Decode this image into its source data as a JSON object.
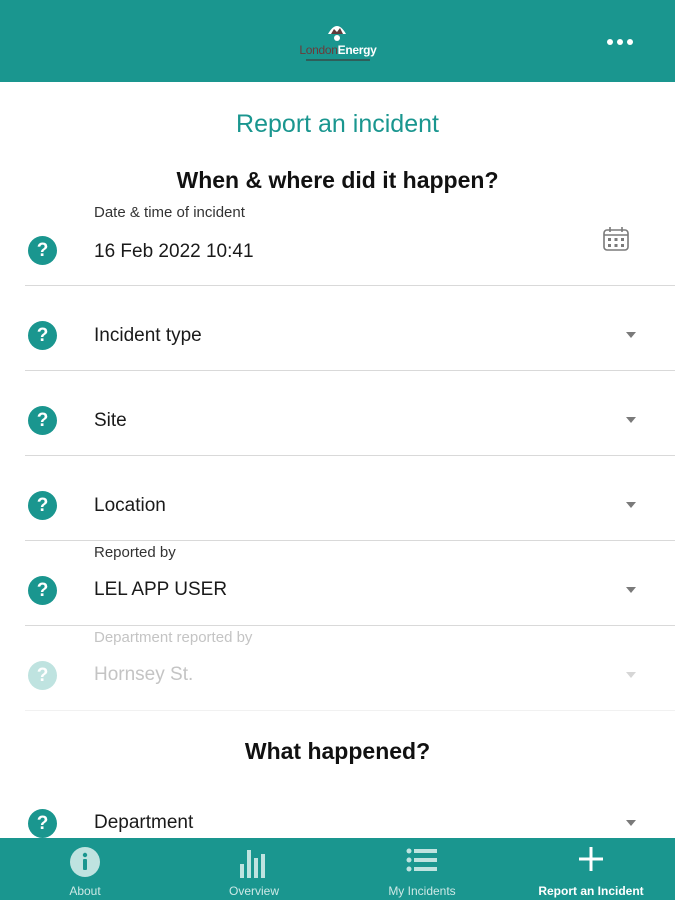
{
  "header": {
    "logo_text_part1": "London",
    "logo_text_part2": "Energy"
  },
  "page": {
    "title": "Report an incident"
  },
  "sections": {
    "when_where": "When & where did it happen?",
    "what_happened": "What happened?"
  },
  "fields": {
    "datetime": {
      "label": "Date & time of incident",
      "value": "16 Feb 2022 10:41"
    },
    "incident_type": {
      "value": "Incident type"
    },
    "site": {
      "value": "Site"
    },
    "location": {
      "value": "Location"
    },
    "reported_by": {
      "label": "Reported by",
      "value": "LEL APP USER"
    },
    "department_reported_by": {
      "label": "Department reported by",
      "value": "Hornsey St."
    },
    "department": {
      "value": "Department"
    }
  },
  "help_glyph": "?",
  "nav": {
    "items": [
      {
        "label": "About",
        "icon": "info-icon"
      },
      {
        "label": "Overview",
        "icon": "bar-chart-icon"
      },
      {
        "label": "My Incidents",
        "icon": "list-icon"
      },
      {
        "label": "Report an Incident",
        "icon": "plus-icon"
      }
    ],
    "active_index": 3
  },
  "colors": {
    "brand_teal": "#1a968f",
    "disabled_text": "#c4c4c4"
  }
}
